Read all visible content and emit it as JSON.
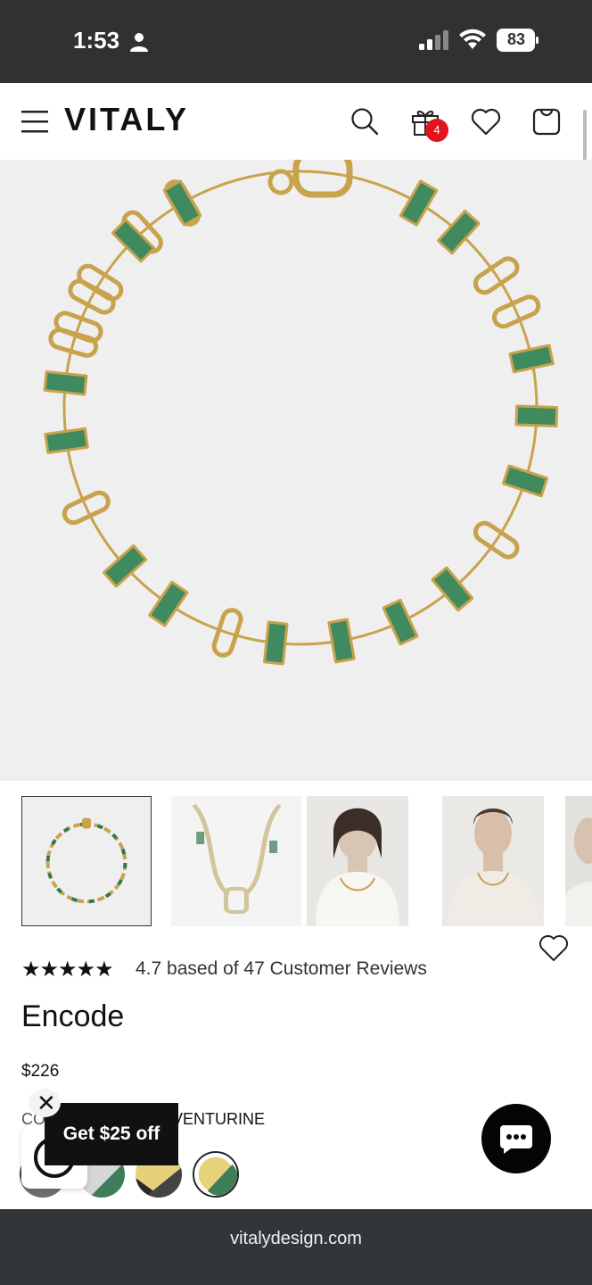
{
  "status_bar": {
    "time": "1:53",
    "battery": "83",
    "icons": [
      "person-icon",
      "signal-icon",
      "wifi-icon",
      "battery-icon"
    ]
  },
  "header": {
    "brand": "VITALY",
    "gift_badge_count": "4",
    "icons": [
      "menu-icon",
      "search-icon",
      "gift-icon",
      "heart-icon",
      "bag-icon"
    ]
  },
  "gallery": {
    "thumbnails": [
      {
        "kind": "necklace-flat",
        "active": true
      },
      {
        "kind": "necklace-clasp-detail",
        "active": false
      },
      {
        "kind": "model-woman",
        "active": false
      },
      {
        "kind": "model-man",
        "active": false
      },
      {
        "kind": "model-partial",
        "active": false
      }
    ]
  },
  "product": {
    "rating_value": 4.7,
    "rating_text": "4.7 based of 47 Customer Reviews",
    "name": "Encode",
    "price": "$226",
    "color_label_visible": "CO",
    "color_value_visible": "VENTURINE",
    "swatches": [
      {
        "name": "black-mix",
        "selected": false
      },
      {
        "name": "green-aventurine-silver",
        "selected": false
      },
      {
        "name": "gold-black",
        "selected": false
      },
      {
        "name": "gold-green-aventurine",
        "selected": true
      }
    ]
  },
  "promo": {
    "label": "Get $25 off",
    "close_glyph": "✕"
  },
  "browser": {
    "url": "vitalydesign.com"
  },
  "colors": {
    "status_bar_bg": "#2f3133",
    "hero_bg": "#efeff0",
    "gold": "#c9a24c",
    "stone_green": "#3f8a5e",
    "badge_red": "#e0141b",
    "promo_bg": "#111111"
  }
}
